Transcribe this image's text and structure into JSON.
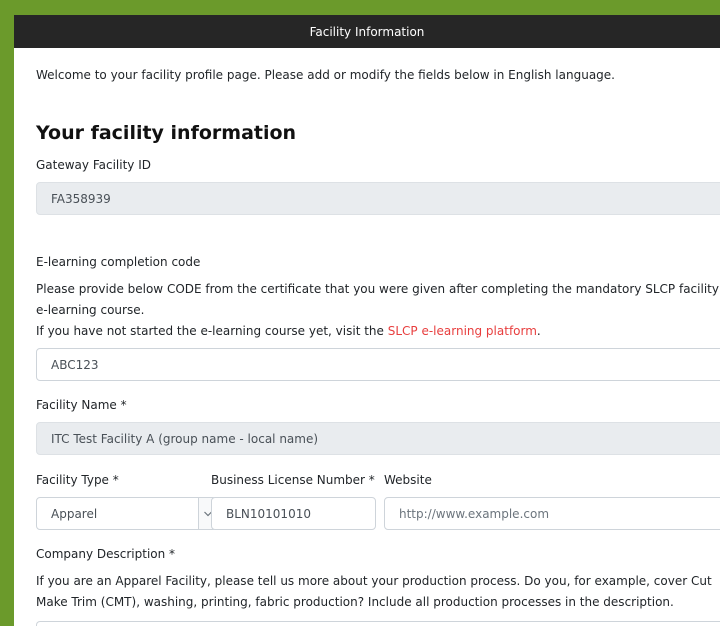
{
  "header": {
    "title": "Facility Information"
  },
  "intro": "Welcome to your facility profile page. Please add or modify the fields below in English language.",
  "section_title": "Your facility information",
  "gateway_id": {
    "label": "Gateway Facility ID",
    "value": "FA358939"
  },
  "elearning": {
    "label": "E-learning completion code",
    "help_line1": "Please provide below CODE from the certificate that you were given after completing the mandatory SLCP facility",
    "help_line2": "e-learning course.",
    "help_line3_prefix": "If you have not started the e-learning course yet, visit the ",
    "help_link": "SLCP e-learning platform",
    "help_line3_suffix": ".",
    "value": "ABC123"
  },
  "facility_name": {
    "label": "Facility Name *",
    "value": "ITC Test Facility A (group name - local name)"
  },
  "facility_type": {
    "label": "Facility Type *",
    "value": "Apparel"
  },
  "business_license": {
    "label": "Business License Number *",
    "value": "BLN10101010"
  },
  "website": {
    "label": "Website",
    "placeholder": "http://www.example.com"
  },
  "company_description": {
    "label": "Company Description *",
    "help_line1": "If you are an Apparel Facility, please tell us more about your production process. Do you, for example, cover Cut",
    "help_line2": "Make Trim (CMT), washing, printing, fabric production? Include all production processes in the description."
  }
}
